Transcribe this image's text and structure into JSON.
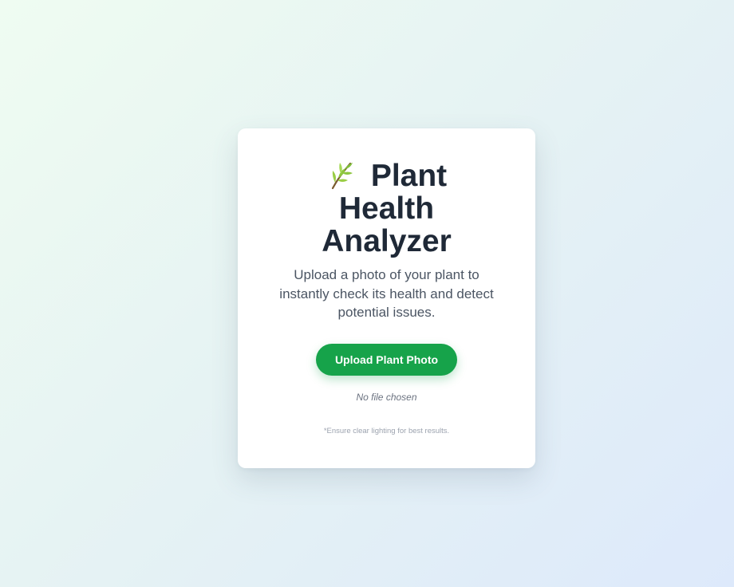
{
  "header": {
    "icon": "leaf-icon",
    "title_line1": "Plant",
    "title_line2": "Health",
    "title_line3": "Analyzer"
  },
  "description": "Upload a photo of your plant to instantly check its health and detect potential issues.",
  "upload": {
    "button_label": "Upload Plant Photo",
    "status_text": "No file chosen"
  },
  "footer_note": "*Ensure clear lighting for best results.",
  "colors": {
    "accent": "#16a34a",
    "title": "#1f2937",
    "body_text": "#4b5563",
    "muted": "#9ca3af",
    "leaf": "#8dc63f"
  }
}
